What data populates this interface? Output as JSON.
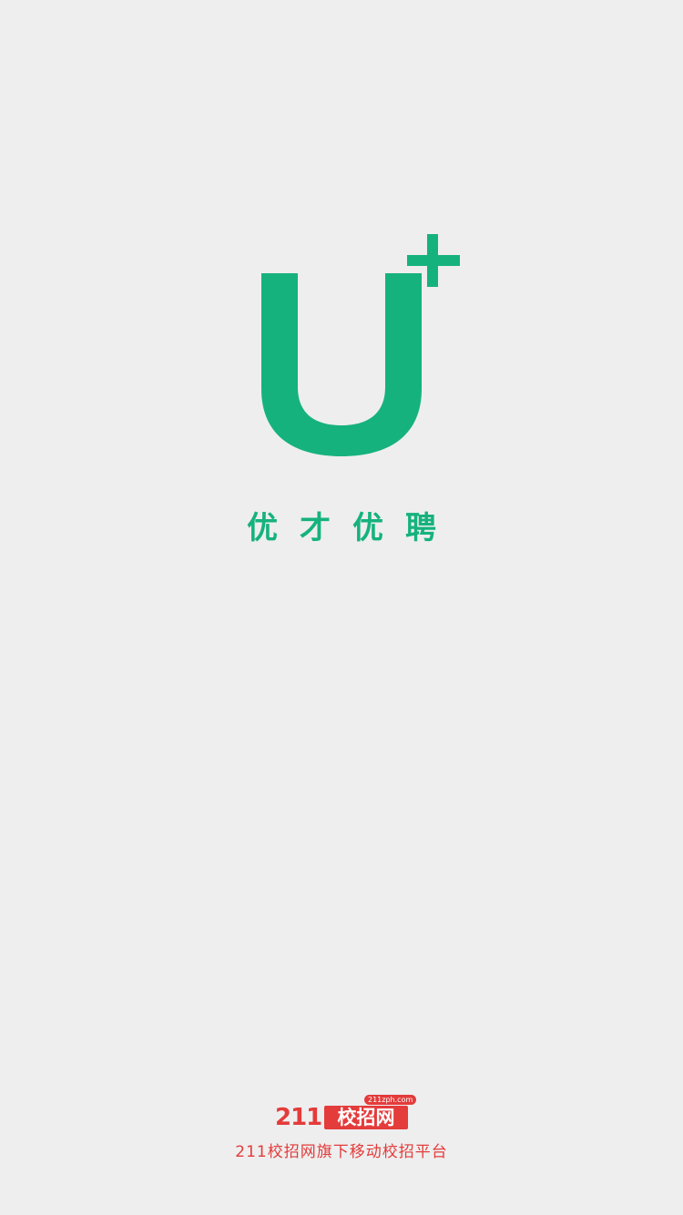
{
  "logo": {
    "icon": "u-plus-logo",
    "color": "#16b27d"
  },
  "app_name": "优才优聘",
  "footer": {
    "brand": {
      "number": "211",
      "name": "校招网",
      "domain": "211zph.com",
      "color": "#e43b3b"
    },
    "tagline": "211校招网旗下移动校招平台",
    "tagline_color": "#e43b3b"
  }
}
